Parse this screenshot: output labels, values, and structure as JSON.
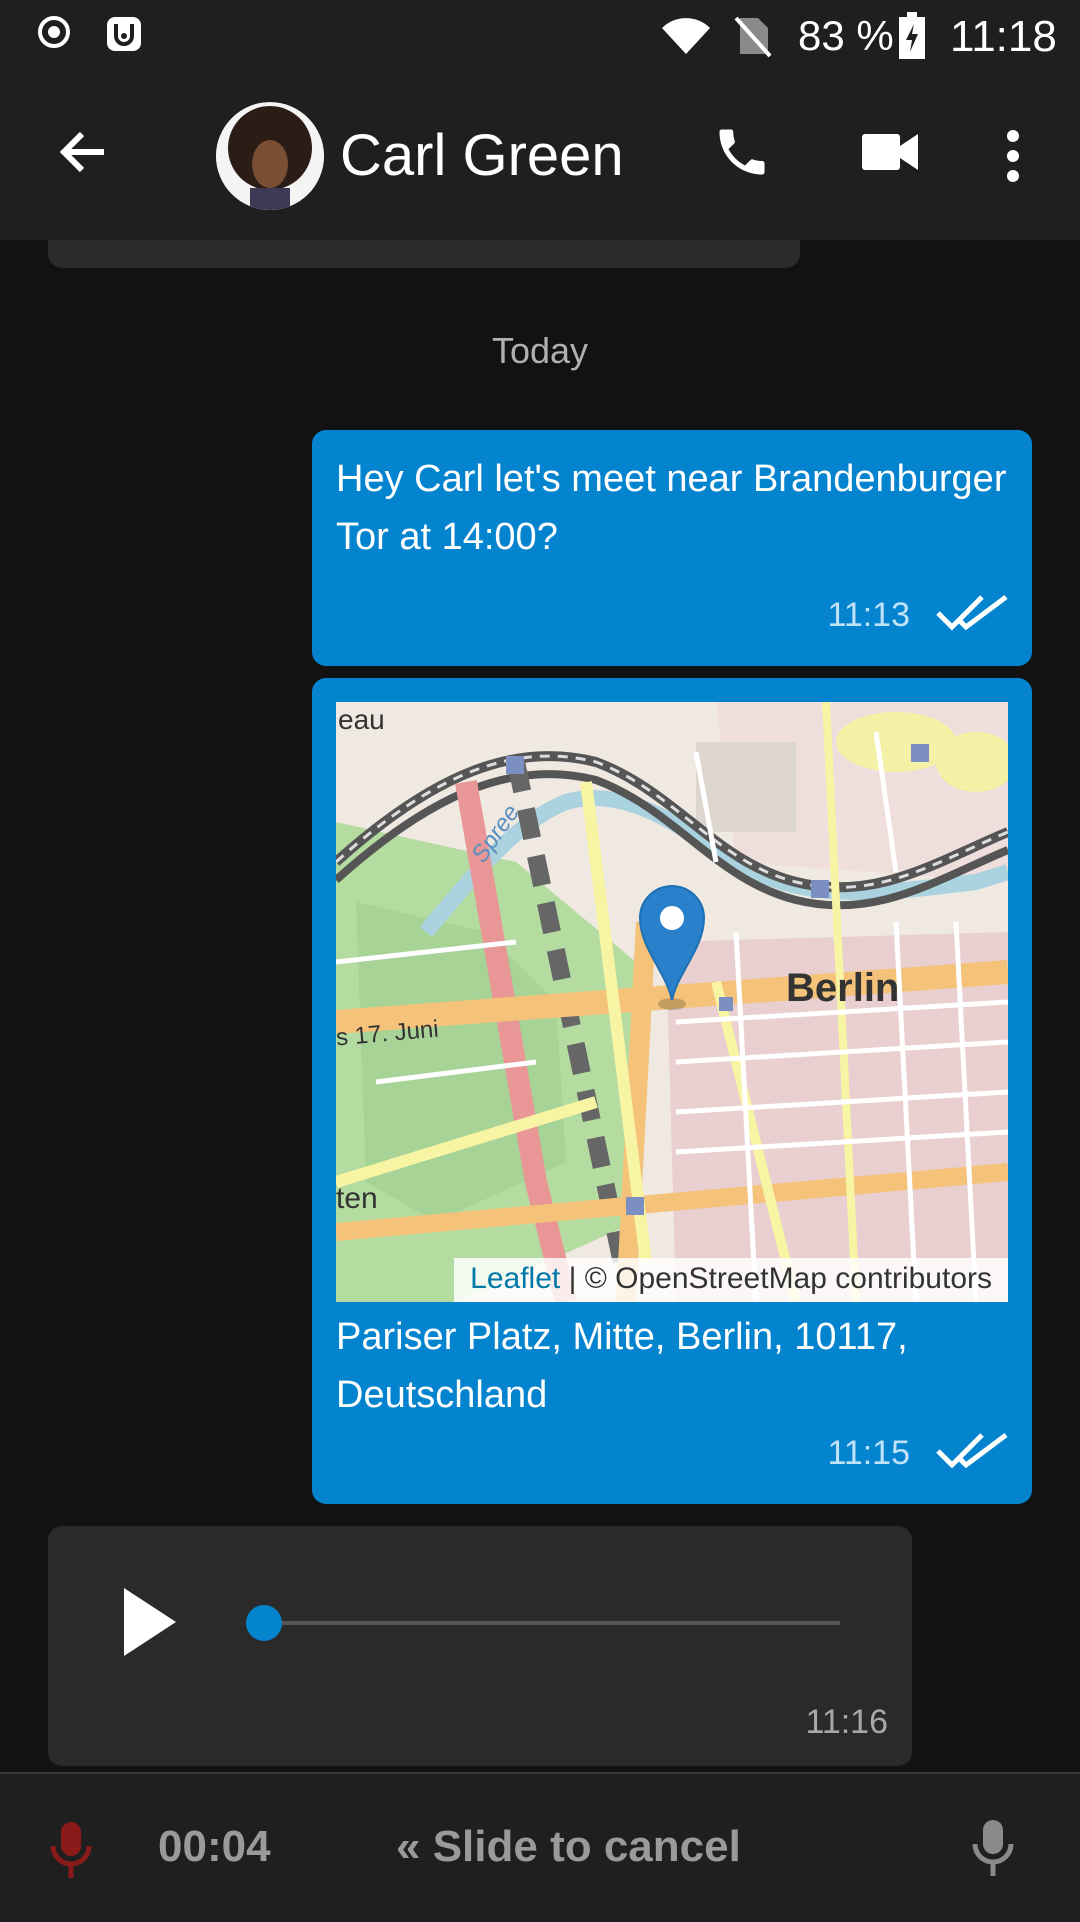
{
  "status_bar": {
    "battery": "83 %",
    "time": "11:18",
    "icons": [
      "record-icon",
      "notification-app-icon",
      "wifi-icon",
      "no-sim-icon",
      "battery-charging-icon"
    ]
  },
  "header": {
    "contact_name": "Carl Green",
    "icons": [
      "back-arrow-icon",
      "avatar",
      "phone-icon",
      "video-camera-icon",
      "more-vert-icon"
    ]
  },
  "chat": {
    "date_separator": "Today",
    "messages": [
      {
        "type": "text",
        "direction": "outgoing",
        "text": "Hey Carl let's meet near Brandenburger Tor at 14:00?",
        "time": "11:13",
        "status_icon": "double-check-icon"
      },
      {
        "type": "location",
        "direction": "outgoing",
        "map": {
          "attribution_link": "Leaflet",
          "attribution_text": " | © OpenStreetMap contributors",
          "city_label": "Berlin",
          "labels": {
            "river": "Spree",
            "road": "s 17. Juni",
            "partial_top": "eau",
            "partial_left": "ten"
          },
          "marker_icon": "map-pin-icon"
        },
        "address": "Pariser Platz, Mitte, Berlin, 10117, Deutschland",
        "time": "11:15",
        "status_icon": "double-check-icon"
      },
      {
        "type": "audio",
        "direction": "incoming",
        "progress": 0,
        "time": "11:16",
        "icon": "play-icon"
      }
    ]
  },
  "recording_bar": {
    "timer": "00:04",
    "slide_to_cancel": "« Slide to cancel",
    "colors": {
      "mic_recording": "#b71c1c"
    }
  },
  "colors": {
    "accent": "#0483cf",
    "background": "#121212",
    "bar": "#1f1f1f",
    "incoming_bubble": "#2a2a2a"
  }
}
